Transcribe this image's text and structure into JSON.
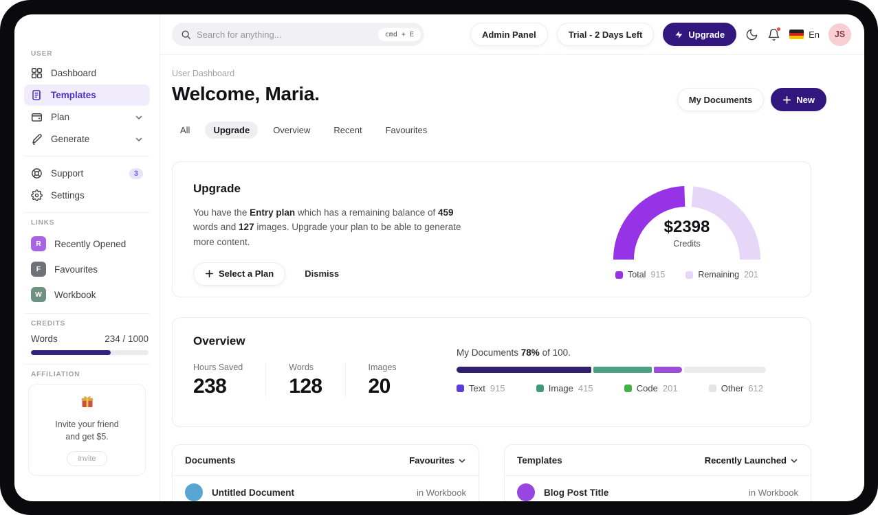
{
  "topbar": {
    "search_placeholder": "Search for anything...",
    "search_shortcut": "cmd + E",
    "admin_panel_label": "Admin Panel",
    "trial_label": "Trial - 2 Days Left",
    "upgrade_label": "Upgrade",
    "language_label": "En",
    "avatar_initials": "JS"
  },
  "sidebar": {
    "user_section_label": "USER",
    "nav": [
      {
        "label": "Dashboard"
      },
      {
        "label": "Templates"
      },
      {
        "label": "Plan"
      },
      {
        "label": "Generate"
      }
    ],
    "support_label": "Support",
    "support_badge": "3",
    "settings_label": "Settings",
    "links_section_label": "LINKS",
    "links": [
      {
        "initial": "R",
        "label": "Recently Opened",
        "color": "#a964e3"
      },
      {
        "initial": "F",
        "label": "Favourites",
        "color": "#717179"
      },
      {
        "initial": "W",
        "label": "Workbook",
        "color": "#6e9184"
      }
    ],
    "credits_section_label": "CREDITS",
    "credits_label": "Words",
    "credits_value": "234 / 1000",
    "credits_percent": 68,
    "affiliation_section_label": "AFFILIATION",
    "affiliation_text_1": "Invite your friend",
    "affiliation_text_2": "and get $5.",
    "invite_label": "Invite"
  },
  "header": {
    "breadcrumb": "User Dashboard",
    "title": "Welcome, Maria.",
    "my_documents_label": "My Documents",
    "new_label": "New",
    "tabs": [
      {
        "label": "All"
      },
      {
        "label": "Upgrade",
        "active": true
      },
      {
        "label": "Overview"
      },
      {
        "label": "Recent"
      },
      {
        "label": "Favourites"
      }
    ]
  },
  "upgrade_card": {
    "title": "Upgrade",
    "body": {
      "t1": "You have the ",
      "b1": "Entry plan",
      "t2": " which has a remaining balance of ",
      "b2": "459",
      "t3": " words and ",
      "b3": "127",
      "t4": " images. Upgrade your plan to be able to generate more content."
    },
    "select_plan_label": "Select a Plan",
    "dismiss_label": "Dismiss",
    "gauge": {
      "center_value": "$2398",
      "center_label": "Credits",
      "legend": [
        {
          "label": "Total",
          "value": "915",
          "color": "#9733e6"
        },
        {
          "label": "Remaining",
          "value": "201",
          "color": "#e6d7f8"
        }
      ]
    }
  },
  "overview_card": {
    "title": "Overview",
    "stats": [
      {
        "label": "Hours Saved",
        "value": "238"
      },
      {
        "label": "Words",
        "value": "128"
      },
      {
        "label": "Images",
        "value": "20"
      }
    ],
    "progress_text": {
      "t1": "My Documents ",
      "b1": "78%",
      "t2": " of 100."
    },
    "legend": [
      {
        "label": "Text",
        "value": "915",
        "color": "#5b3ddb"
      },
      {
        "label": "Image",
        "value": "415",
        "color": "#41997c"
      },
      {
        "label": "Code",
        "value": "201",
        "color": "#43b04a"
      },
      {
        "label": "Other",
        "value": "612",
        "color": "#e4e4e7"
      }
    ]
  },
  "documents_card": {
    "title": "Documents",
    "filter_label": "Favourites",
    "rows": [
      {
        "name": "Untitled Document",
        "location": "in Workbook",
        "avatar_color": "#56a5d2"
      }
    ]
  },
  "templates_card": {
    "title": "Templates",
    "filter_label": "Recently Launched",
    "rows": [
      {
        "name": "Blog Post Title",
        "location": "in Workbook",
        "avatar_color": "#9747e0"
      }
    ]
  },
  "chart_data": [
    {
      "type": "pie",
      "subtype": "semicircle-gauge",
      "title": "Credits",
      "center_value": "$2398",
      "series": [
        {
          "name": "Total",
          "value": 915,
          "color": "#9733e6"
        },
        {
          "name": "Remaining",
          "value": 201,
          "color": "#e6d7f8"
        }
      ],
      "legend_position": "bottom"
    },
    {
      "type": "bar",
      "subtype": "stacked-progress",
      "title": "My Documents 78% of 100.",
      "percent": 78,
      "series": [
        {
          "name": "Text",
          "value": 915,
          "bar_color": "#33206b",
          "legend_color": "#5b3ddb",
          "width_pct": 43.5
        },
        {
          "name": "Image",
          "value": 415,
          "bar_color": "#4da183",
          "legend_color": "#41997c",
          "width_pct": 19
        },
        {
          "name": "Code",
          "value": 201,
          "bar_color": "#9b4fd6",
          "legend_color": "#43b04a",
          "width_pct": 9
        },
        {
          "name": "Other",
          "value": 612,
          "bar_color": "#ebebee",
          "legend_color": "#e4e4e7",
          "width_pct": 28.5
        }
      ],
      "legend_position": "bottom"
    }
  ],
  "colors": {
    "accent_primary": "#32187e",
    "sidebar_active": "#4c2ec2",
    "gauge_total": "#9733e6",
    "gauge_remaining": "#e6d7f8",
    "notification_dot": "#ef4444"
  }
}
